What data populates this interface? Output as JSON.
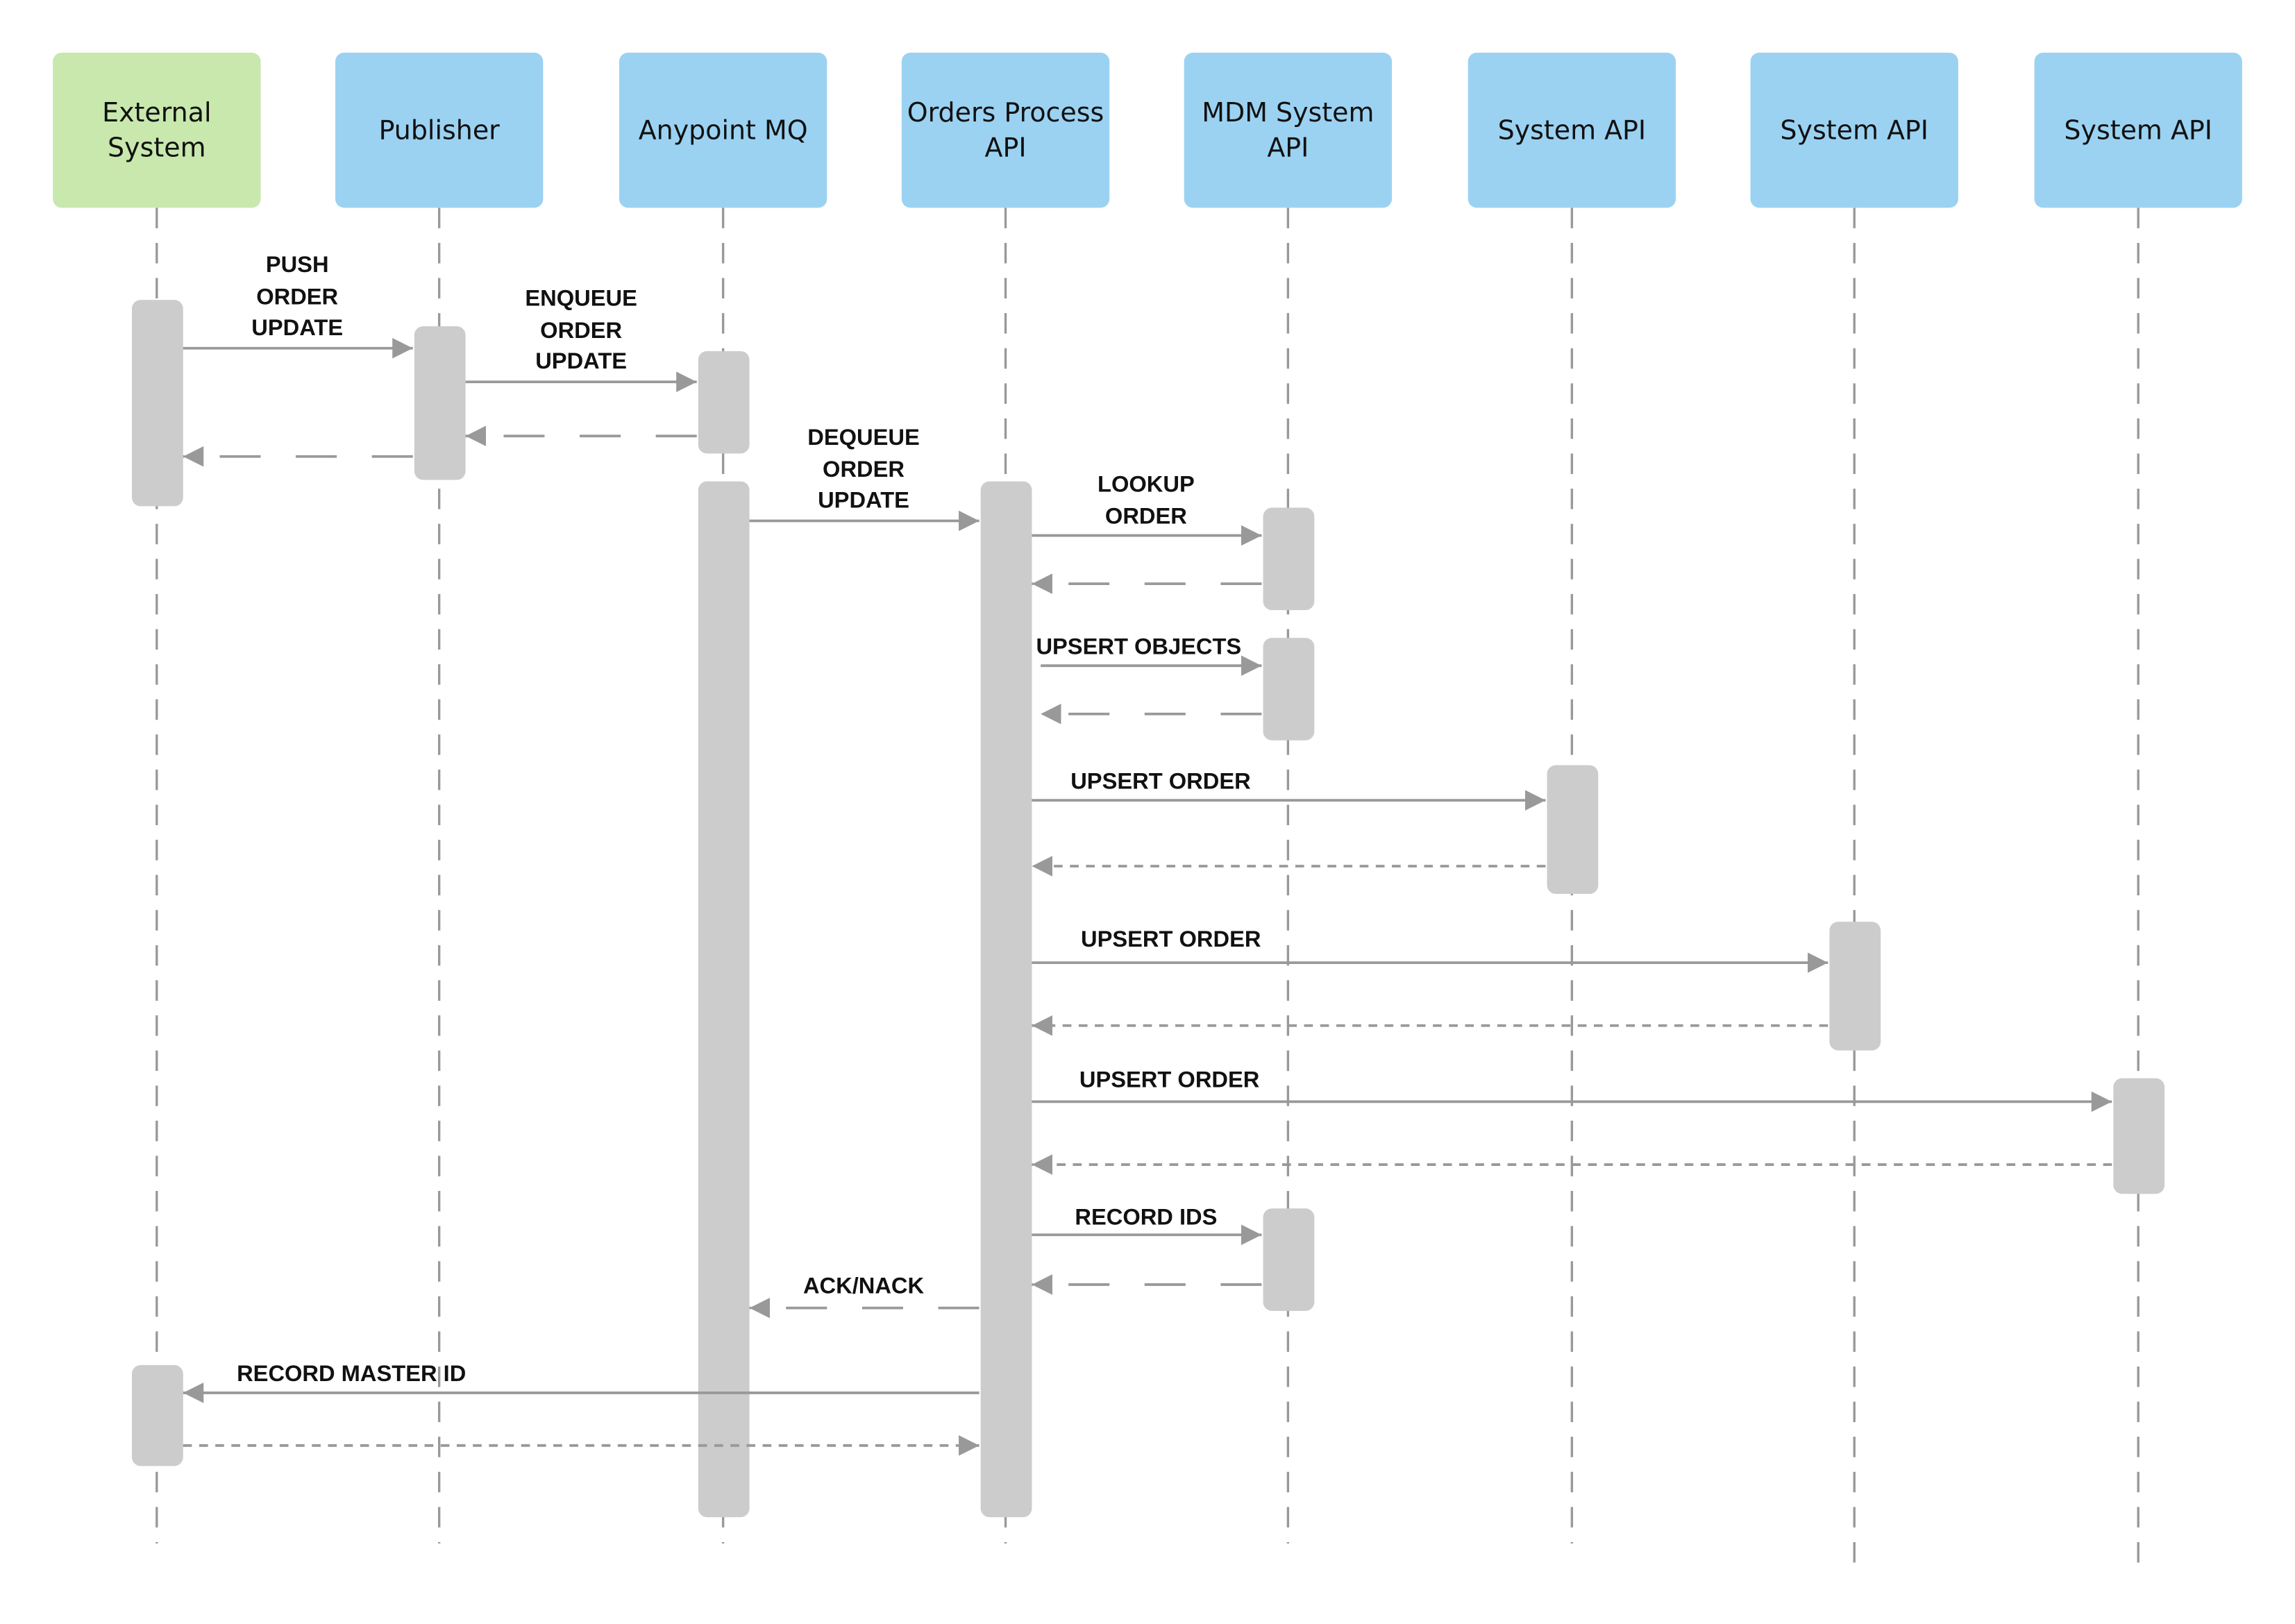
{
  "colors": {
    "external": "#c8e8ad",
    "service": "#9bd2f2",
    "activation": "#cccccc",
    "line": "#999999",
    "text": "#111111"
  },
  "participants": [
    {
      "id": "ext",
      "label": [
        "External",
        "System"
      ],
      "kind": "external"
    },
    {
      "id": "pub",
      "label": [
        "Publisher"
      ],
      "kind": "service"
    },
    {
      "id": "mq",
      "label": [
        "Anypoint MQ"
      ],
      "kind": "service"
    },
    {
      "id": "opa",
      "label": [
        "Orders Process",
        "API"
      ],
      "kind": "service"
    },
    {
      "id": "mdm",
      "label": [
        "MDM System",
        "API"
      ],
      "kind": "service"
    },
    {
      "id": "sys1",
      "label": [
        "System API"
      ],
      "kind": "service"
    },
    {
      "id": "sys2",
      "label": [
        "System API"
      ],
      "kind": "service"
    },
    {
      "id": "sys3",
      "label": [
        "System API"
      ],
      "kind": "service"
    }
  ],
  "messages": [
    {
      "from": "ext",
      "to": "pub",
      "label": [
        "PUSH",
        "ORDER",
        "UPDATE"
      ],
      "style": "sync"
    },
    {
      "from": "pub",
      "to": "mq",
      "label": [
        "ENQUEUE",
        "ORDER",
        "UPDATE"
      ],
      "style": "sync"
    },
    {
      "from": "mq",
      "to": "pub",
      "label": [],
      "style": "return"
    },
    {
      "from": "pub",
      "to": "ext",
      "label": [],
      "style": "return"
    },
    {
      "from": "mq",
      "to": "opa",
      "label": [
        "DEQUEUE",
        "ORDER",
        "UPDATE"
      ],
      "style": "sync"
    },
    {
      "from": "opa",
      "to": "mdm",
      "label": [
        "LOOKUP",
        "ORDER"
      ],
      "style": "sync"
    },
    {
      "from": "mdm",
      "to": "opa",
      "label": [],
      "style": "return"
    },
    {
      "from": "opa",
      "to": "mdm",
      "label": [
        "UPSERT OBJECTS"
      ],
      "style": "sync"
    },
    {
      "from": "mdm",
      "to": "opa",
      "label": [],
      "style": "return"
    },
    {
      "from": "opa",
      "to": "sys1",
      "label": [
        "UPSERT ORDER"
      ],
      "style": "sync"
    },
    {
      "from": "sys1",
      "to": "opa",
      "label": [],
      "style": "return-dotted"
    },
    {
      "from": "opa",
      "to": "sys2",
      "label": [
        "UPSERT ORDER"
      ],
      "style": "sync"
    },
    {
      "from": "sys2",
      "to": "opa",
      "label": [],
      "style": "return-dotted"
    },
    {
      "from": "opa",
      "to": "sys3",
      "label": [
        "UPSERT ORDER"
      ],
      "style": "sync"
    },
    {
      "from": "sys3",
      "to": "opa",
      "label": [],
      "style": "return-dotted"
    },
    {
      "from": "opa",
      "to": "mdm",
      "label": [
        "RECORD IDS"
      ],
      "style": "sync"
    },
    {
      "from": "mdm",
      "to": "opa",
      "label": [],
      "style": "return"
    },
    {
      "from": "opa",
      "to": "mq",
      "label": [
        "ACK/NACK"
      ],
      "style": "return"
    },
    {
      "from": "opa",
      "to": "ext",
      "label": [
        "RECORD  MASTER  ID"
      ],
      "style": "sync"
    },
    {
      "from": "ext",
      "to": "opa",
      "label": [],
      "style": "return-dotted"
    }
  ]
}
